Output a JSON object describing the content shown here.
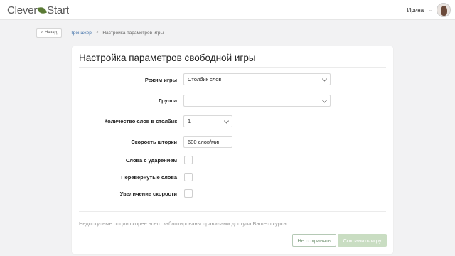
{
  "header": {
    "logo_left": "Clever",
    "logo_right": "Start",
    "user_name": "Ирина",
    "user_caret": "⌄"
  },
  "breadcrumb": {
    "back_label": "Назад",
    "back_icon": "‹",
    "link_label": "Тренажер",
    "separator": ">",
    "current_label": "Настройка параметров игры"
  },
  "form": {
    "title": "Настройка параметров свободной игры",
    "fields": {
      "mode": {
        "label": "Режим игры",
        "value": "Столбик слов"
      },
      "group": {
        "label": "Группа",
        "value": ""
      },
      "words_count": {
        "label": "Количество слов в столбик",
        "value": "1"
      },
      "speed": {
        "label": "Скорость шторки",
        "value": "600 слов/мин"
      },
      "stress": {
        "label": "Слова с ударением",
        "checked": false
      },
      "inverted": {
        "label": "Перевернутые слова",
        "checked": false
      },
      "speed_up": {
        "label": "Увеличение скорости",
        "checked": false
      }
    },
    "note": "Недоступные опции скорее всего заблокированы правилами доступа Вашего курса.",
    "buttons": {
      "cancel": "Не сохранять",
      "save": "Сохранить игру"
    }
  },
  "colors": {
    "background": "#f2f2f3",
    "link": "#3d6ea8",
    "save_button": "#c9ddc2",
    "cancel_border": "#b5c9b5",
    "logo_leaf": "#5a7a34"
  }
}
